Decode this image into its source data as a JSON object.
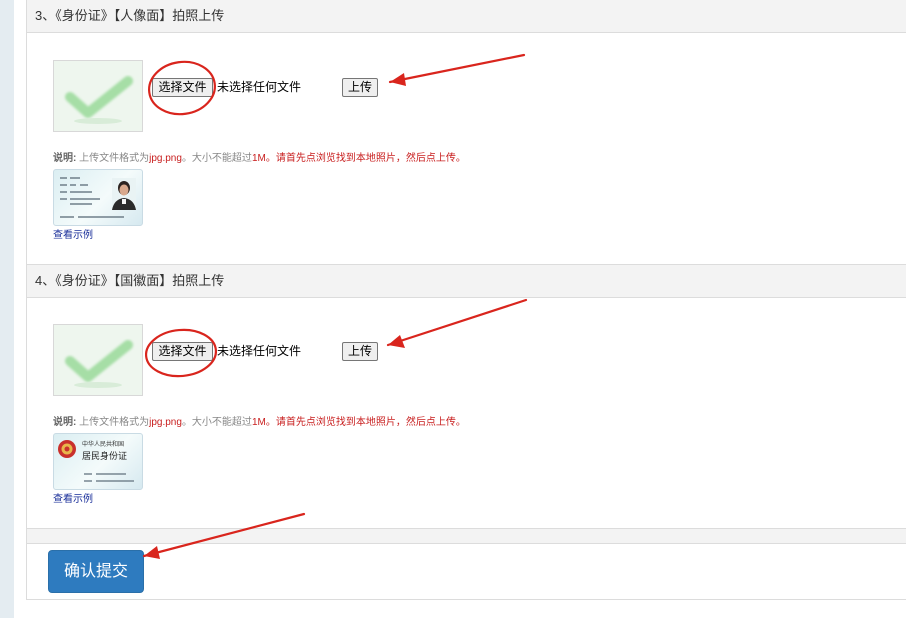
{
  "sections": [
    {
      "title": "3、《身份证》【人像面】拍照上传",
      "choose_label": "选择文件",
      "no_file_text": "未选择任何文件",
      "upload_label": "上传",
      "note_label": "说明:",
      "note_format_prefix": "上传文件格式为",
      "note_format_value": "jpg.png",
      "note_size_prefix": "。大小不能超过",
      "note_size_value": "1M",
      "note_instruction": "。请首先点浏览找到本地照片，然后点上传。",
      "sample_link": "查看示例"
    },
    {
      "title": "4、《身份证》【国徽面】拍照上传",
      "choose_label": "选择文件",
      "no_file_text": "未选择任何文件",
      "upload_label": "上传",
      "note_label": "说明:",
      "note_format_prefix": "上传文件格式为",
      "note_format_value": "jpg.png",
      "note_size_prefix": "。大小不能超过",
      "note_size_value": "1M",
      "note_instruction": "。请首先点浏览找到本地照片，然后点上传。",
      "sample_link": "查看示例",
      "card_header": "中华人民共和国",
      "card_title": "居民身份证"
    }
  ],
  "submit_label": "确认提交",
  "colors": {
    "accent": "#2e7bbf",
    "annotation_red": "#d9251d",
    "note_red": "#c81e1e",
    "link_blue": "#1a2f9a",
    "check_green": "#9fdb9f"
  },
  "icons": {
    "placeholder": "check-mark-icon",
    "emblem": "national-emblem-icon",
    "arrow": "annotation-arrow-icon",
    "circle": "annotation-circle-icon"
  }
}
